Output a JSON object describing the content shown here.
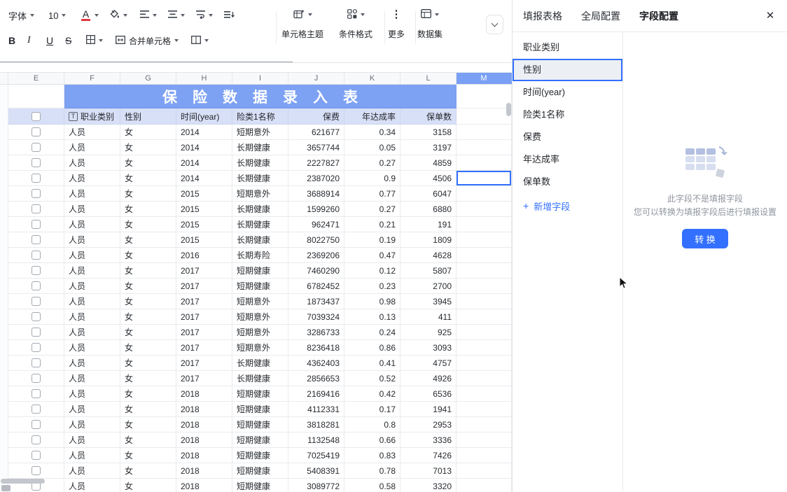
{
  "toolbar": {
    "font_label": "字体",
    "font_size": "10",
    "font_color_letter": "A",
    "bold": "B",
    "italic": "I",
    "underline": "U",
    "strikethrough": "S",
    "merge_cells_label": "合并单元格",
    "cell_theme_label": "单元格主题",
    "conditional_format_label": "条件格式",
    "more_label": "更多",
    "dataset_label": "数据集"
  },
  "sheet": {
    "column_letters": [
      "E",
      "F",
      "G",
      "H",
      "I",
      "J",
      "K",
      "L",
      "M"
    ],
    "active_column": "M",
    "title": "保险数据录入表",
    "header_icon": "T",
    "headers": [
      "职业类别",
      "性别",
      "时间(year)",
      "险类1名称",
      "保费",
      "年达成率",
      "保单数"
    ],
    "selected_cell": {
      "column": "M",
      "row_index": 4
    },
    "rows": [
      [
        "人员",
        "女",
        "2014",
        "短期意外",
        "621677",
        "0.34",
        "3158"
      ],
      [
        "人员",
        "女",
        "2014",
        "长期健康",
        "3657744",
        "0.05",
        "3197"
      ],
      [
        "人员",
        "女",
        "2014",
        "长期健康",
        "2227827",
        "0.27",
        "4859"
      ],
      [
        "人员",
        "女",
        "2014",
        "长期健康",
        "2387020",
        "0.9",
        "4506"
      ],
      [
        "人员",
        "女",
        "2015",
        "短期意外",
        "3688914",
        "0.77",
        "6047"
      ],
      [
        "人员",
        "女",
        "2015",
        "长期健康",
        "1599260",
        "0.27",
        "6880"
      ],
      [
        "人员",
        "女",
        "2015",
        "长期健康",
        "962471",
        "0.21",
        "191"
      ],
      [
        "人员",
        "女",
        "2015",
        "长期健康",
        "8022750",
        "0.19",
        "1809"
      ],
      [
        "人员",
        "女",
        "2016",
        "长期寿险",
        "2369206",
        "0.47",
        "4628"
      ],
      [
        "人员",
        "女",
        "2017",
        "短期健康",
        "7460290",
        "0.12",
        "5807"
      ],
      [
        "人员",
        "女",
        "2017",
        "短期健康",
        "6782452",
        "0.23",
        "2700"
      ],
      [
        "人员",
        "女",
        "2017",
        "短期意外",
        "1873437",
        "0.98",
        "3945"
      ],
      [
        "人员",
        "女",
        "2017",
        "短期意外",
        "7039324",
        "0.13",
        "411"
      ],
      [
        "人员",
        "女",
        "2017",
        "短期意外",
        "3286733",
        "0.24",
        "925"
      ],
      [
        "人员",
        "女",
        "2017",
        "短期意外",
        "8236418",
        "0.86",
        "3093"
      ],
      [
        "人员",
        "女",
        "2017",
        "长期健康",
        "4362403",
        "0.41",
        "4757"
      ],
      [
        "人员",
        "女",
        "2017",
        "长期健康",
        "2856653",
        "0.52",
        "4926"
      ],
      [
        "人员",
        "女",
        "2018",
        "短期健康",
        "2169416",
        "0.42",
        "6536"
      ],
      [
        "人员",
        "女",
        "2018",
        "短期健康",
        "4112331",
        "0.17",
        "1941"
      ],
      [
        "人员",
        "女",
        "2018",
        "短期健康",
        "3818281",
        "0.8",
        "2953"
      ],
      [
        "人员",
        "女",
        "2018",
        "短期健康",
        "1132548",
        "0.66",
        "3336"
      ],
      [
        "人员",
        "女",
        "2018",
        "短期健康",
        "7025419",
        "0.83",
        "7426"
      ],
      [
        "人员",
        "女",
        "2018",
        "短期健康",
        "5408391",
        "0.78",
        "7013"
      ],
      [
        "人员",
        "女",
        "2018",
        "短期健康",
        "3089772",
        "0.58",
        "3320"
      ]
    ]
  },
  "panel": {
    "tabs": [
      "填报表格",
      "全局配置",
      "字段配置"
    ],
    "active_tab": "字段配置",
    "close_icon": "✕",
    "fields": [
      "职业类别",
      "性别",
      "时间(year)",
      "险类1名称",
      "保费",
      "年达成率",
      "保单数"
    ],
    "selected_field": "性别",
    "add_field_plus": "+",
    "add_field": "新增字段",
    "empty_line1": "此字段不是填报字段",
    "empty_line2": "您可以转换为填报字段后进行填报设置",
    "convert_button": "转 换"
  },
  "colors": {
    "accent": "#3370ff",
    "title_bg": "#7da1f3",
    "header_row_bg": "#d8e0f7",
    "active_column_bg": "#79a0f4"
  }
}
